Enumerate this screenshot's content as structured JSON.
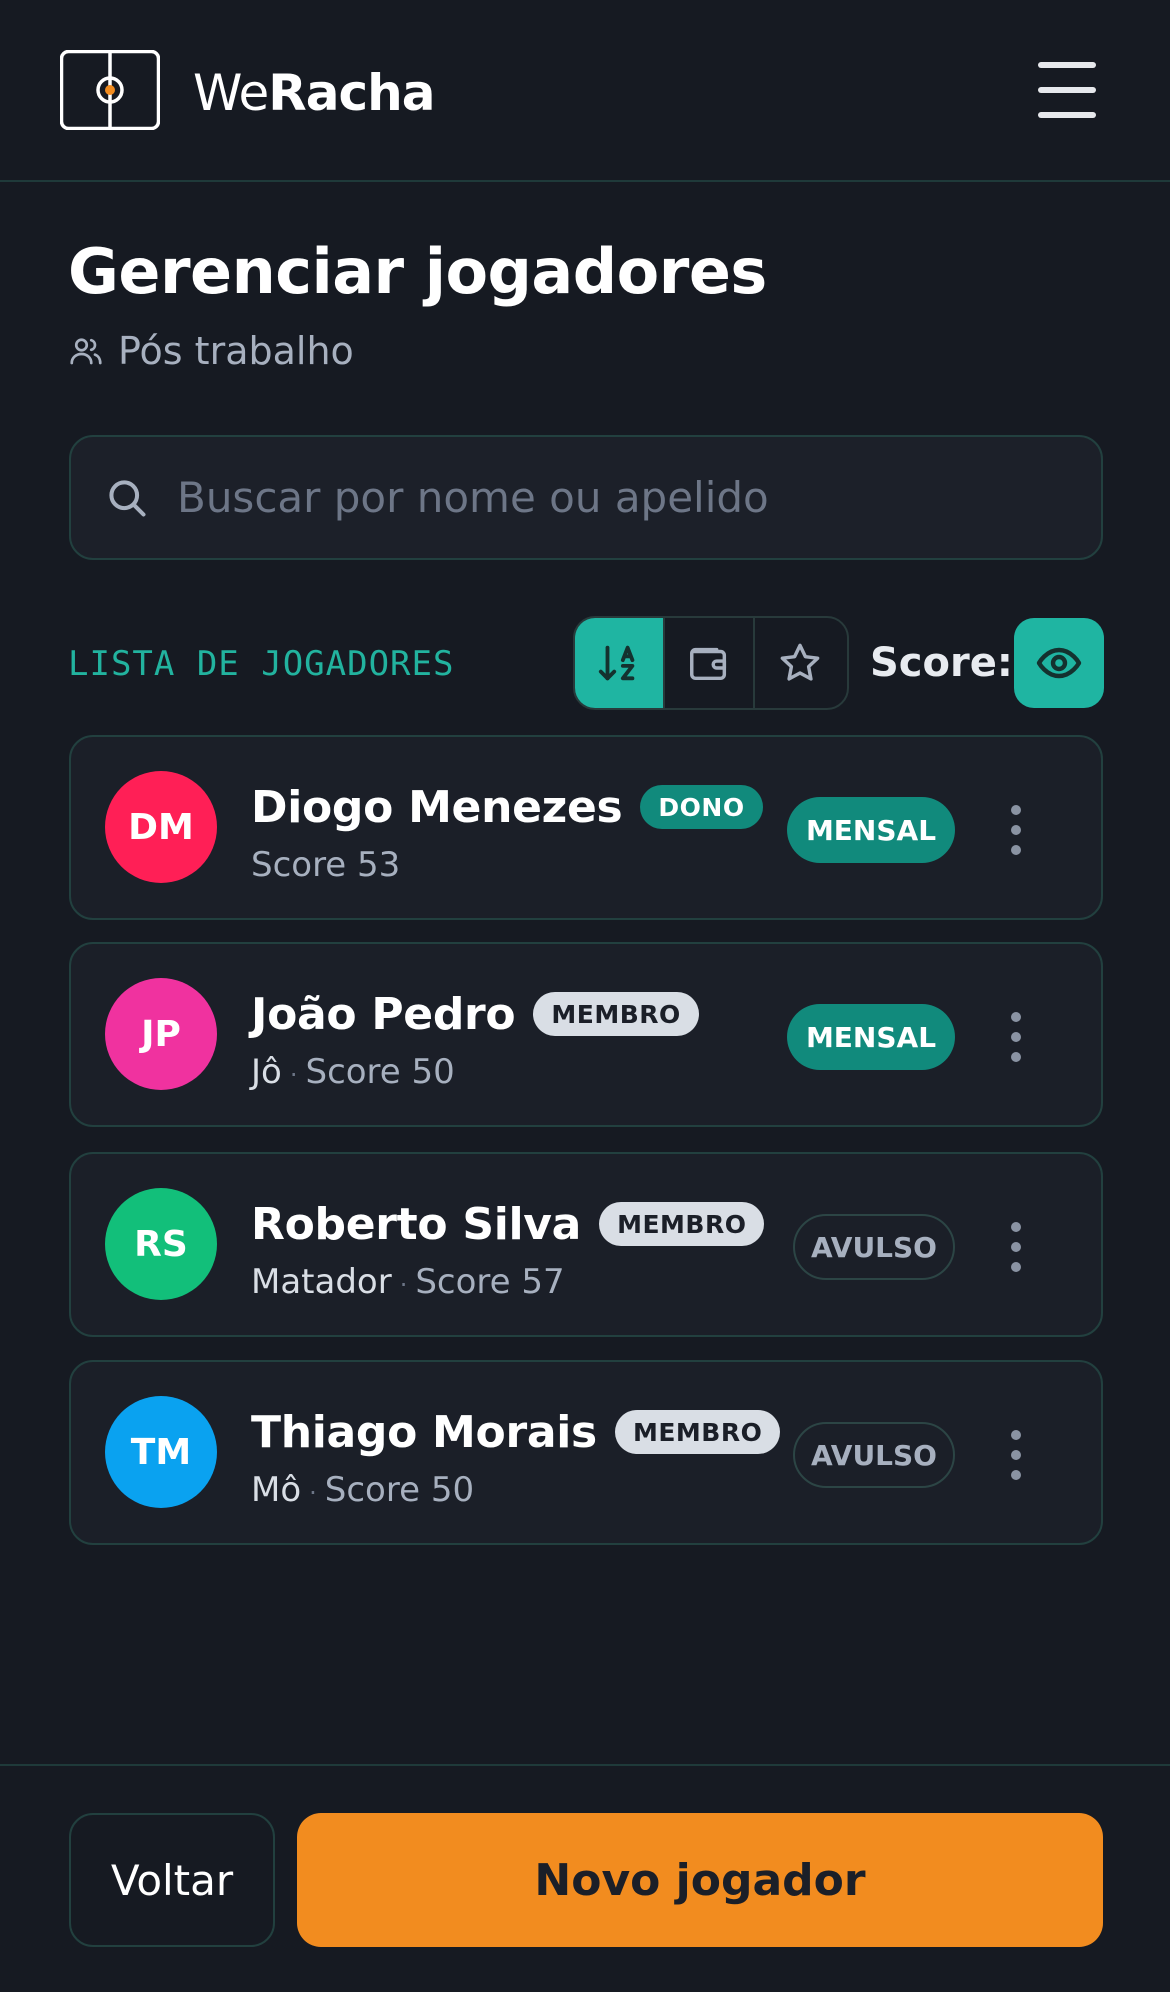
{
  "header": {
    "logo_light": "We",
    "logo_bold": "Racha",
    "menu_icon": "hamburger-menu-icon"
  },
  "page": {
    "title": "Gerenciar jogadores",
    "group_icon": "users-icon",
    "group_name": "Pós trabalho"
  },
  "search": {
    "placeholder": "Buscar por nome ou apelido",
    "icon": "search-icon"
  },
  "list": {
    "label": "LISTA DE JOGADORES",
    "sort_buttons": [
      {
        "icon": "sort-alpha-icon",
        "active": true
      },
      {
        "icon": "wallet-icon",
        "active": false
      },
      {
        "icon": "star-icon",
        "active": false
      }
    ],
    "score_label": "Score:",
    "score_toggle_icon": "eye-icon"
  },
  "players": [
    {
      "initials": "DM",
      "avatar_color": "#ff1f56",
      "name": "Diogo Menezes",
      "role": "DONO",
      "nickname": "",
      "score": "Score 53",
      "plan": "MENSAL"
    },
    {
      "initials": "JP",
      "avatar_color": "#f0329f",
      "name": "João Pedro",
      "role": "MEMBRO",
      "nickname": "Jô",
      "score": "Score 50",
      "plan": "MENSAL"
    },
    {
      "initials": "RS",
      "avatar_color": "#12bf7a",
      "name": "Roberto Silva",
      "role": "MEMBRO",
      "nickname": "Matador",
      "score": "Score 57",
      "plan": "AVULSO"
    },
    {
      "initials": "TM",
      "avatar_color": "#0aa2f0",
      "name": "Thiago Morais",
      "role": "MEMBRO",
      "nickname": "Mô",
      "score": "Score 50",
      "plan": "AVULSO"
    }
  ],
  "footer": {
    "back_label": "Voltar",
    "new_label": "Novo jogador"
  },
  "colors": {
    "background": "#161a22",
    "accent": "#1fb5a2",
    "primary_button": "#f28c1f"
  }
}
